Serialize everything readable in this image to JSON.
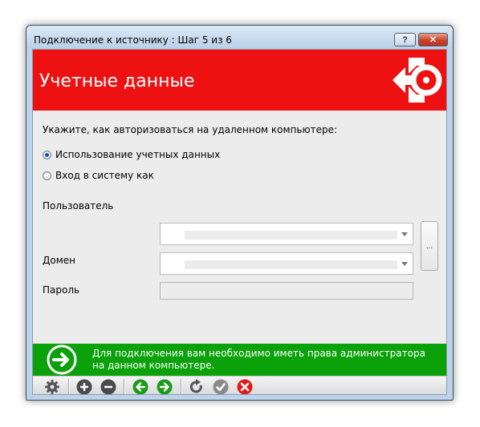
{
  "window": {
    "title": "Подключение к источнику : Шаг 5 из 6",
    "help_label": "?",
    "close_label": "✕"
  },
  "banner": {
    "title": "Учетные данные"
  },
  "form": {
    "prompt": "Укажите, как авторизоваться на удаленном компьютере:",
    "radio_use_credentials": "Использование учетных данных",
    "radio_login_as": "Вход в систему как",
    "selected_option": "radio_use_credentials",
    "user_label": "Пользователь",
    "domain_label": "Домен",
    "password_label": "Пароль",
    "user_value": "",
    "domain_value": "",
    "password_value": "",
    "browse_label": "..."
  },
  "info": {
    "text": "Для подключения вам необходимо иметь права администратора на данном компьютере."
  },
  "toolbar": {
    "icons": [
      "gear-icon",
      "plus-icon",
      "minus-icon",
      "back-icon",
      "forward-icon",
      "refresh-icon",
      "check-icon",
      "close-icon"
    ]
  },
  "colors": {
    "banner_red": "#ee1111",
    "info_green": "#0aa10a",
    "client_bg": "#ececec"
  }
}
